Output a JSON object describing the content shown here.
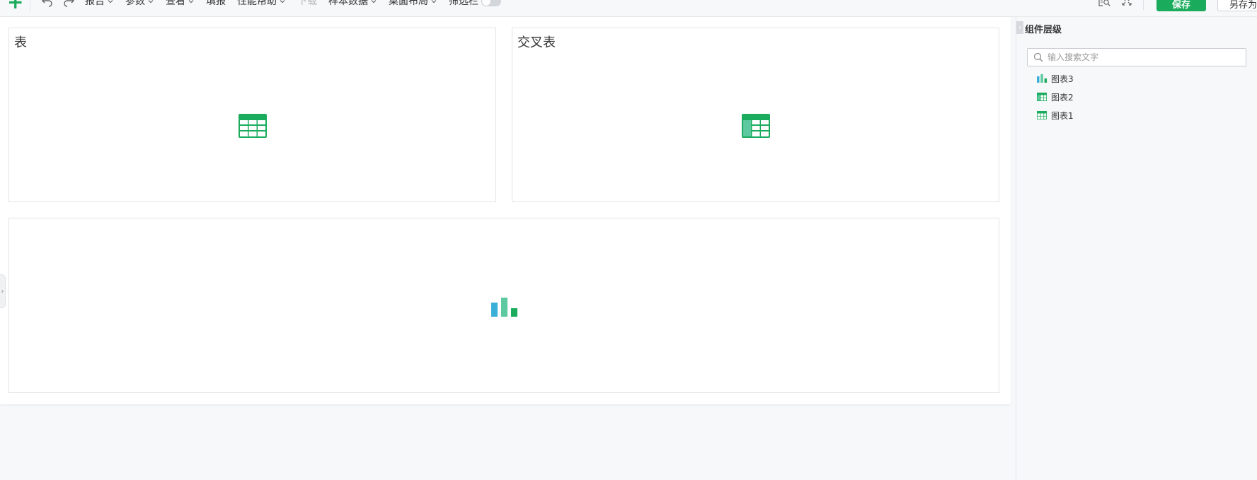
{
  "toolbar": {
    "menus": [
      {
        "label": "报告",
        "has_dropdown": true,
        "disabled": false
      },
      {
        "label": "参数",
        "has_dropdown": true,
        "disabled": false
      },
      {
        "label": "查看",
        "has_dropdown": true,
        "disabled": false
      },
      {
        "label": "填报",
        "has_dropdown": false,
        "disabled": false
      },
      {
        "label": "性能帮助",
        "has_dropdown": true,
        "disabled": false
      },
      {
        "label": "下载",
        "has_dropdown": false,
        "disabled": true
      },
      {
        "label": "样本数据",
        "has_dropdown": true,
        "disabled": false
      },
      {
        "label": "桌面布局",
        "has_dropdown": true,
        "disabled": false
      }
    ],
    "filter_bar_label": "筛选栏",
    "filter_bar_on": false,
    "save_label": "保存",
    "save_as_label": "另存为"
  },
  "widgets": [
    {
      "title": "表",
      "icon": "table-icon"
    },
    {
      "title": "交叉表",
      "icon": "crosstab-icon"
    },
    {
      "title": "",
      "icon": "bar-chart-icon"
    }
  ],
  "panel": {
    "title": "组件层级",
    "search_placeholder": "输入搜索文字",
    "items": [
      {
        "label": "图表3",
        "icon": "bar-chart-icon"
      },
      {
        "label": "图表2",
        "icon": "crosstab-icon"
      },
      {
        "label": "图表1",
        "icon": "table-icon"
      }
    ]
  },
  "colors": {
    "accent": "#1aac5c",
    "chart_blue": "#3ab0d8",
    "chart_teal": "#5cc9a0",
    "chart_green": "#1aac5c"
  }
}
